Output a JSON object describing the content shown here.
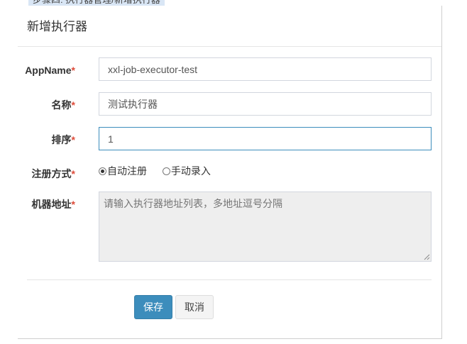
{
  "background_page": {
    "partial_text": "步骤四: 执行器管理/新增执行器"
  },
  "modal": {
    "title": "新增执行器",
    "fields": {
      "appname": {
        "label": "AppName",
        "required_mark": "*",
        "value": "xxl-job-executor-test"
      },
      "name": {
        "label": "名称",
        "required_mark": "*",
        "value": "测试执行器"
      },
      "order": {
        "label": "排序",
        "required_mark": "*",
        "value": "1"
      },
      "register_type": {
        "label": "注册方式",
        "required_mark": "*",
        "options": [
          {
            "label": "自动注册",
            "checked": true
          },
          {
            "label": "手动录入",
            "checked": false
          }
        ]
      },
      "address": {
        "label": "机器地址",
        "required_mark": "*",
        "placeholder": "请输入执行器地址列表，多地址逗号分隔",
        "value": ""
      }
    },
    "buttons": {
      "save": "保存",
      "cancel": "取消"
    }
  },
  "colors": {
    "primary": "#3c8dbc",
    "required": "#dd4b39",
    "disabled_bg": "#eeeeee"
  }
}
